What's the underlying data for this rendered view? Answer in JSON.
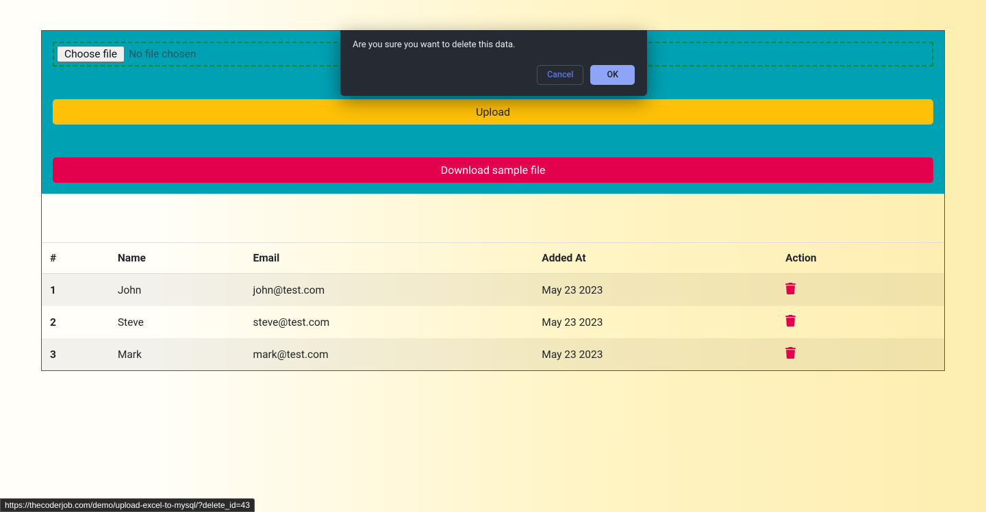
{
  "dialog": {
    "message": "Are you sure you want to delete this data.",
    "cancel": "Cancel",
    "ok": "OK"
  },
  "filePicker": {
    "button": "Choose file",
    "status": "No file chosen"
  },
  "buttons": {
    "upload": "Upload",
    "download": "Download sample file"
  },
  "table": {
    "headers": {
      "idx": "#",
      "name": "Name",
      "email": "Email",
      "added": "Added At",
      "action": "Action"
    },
    "rows": [
      {
        "idx": "1",
        "name": "John",
        "email": "john@test.com",
        "added": "May 23 2023"
      },
      {
        "idx": "2",
        "name": "Steve",
        "email": "steve@test.com",
        "added": "May 23 2023"
      },
      {
        "idx": "3",
        "name": "Mark",
        "email": "mark@test.com",
        "added": "May 23 2023"
      }
    ]
  },
  "statusBar": "https://thecoderjob.com/demo/upload-excel-to-mysql/?delete_id=43"
}
